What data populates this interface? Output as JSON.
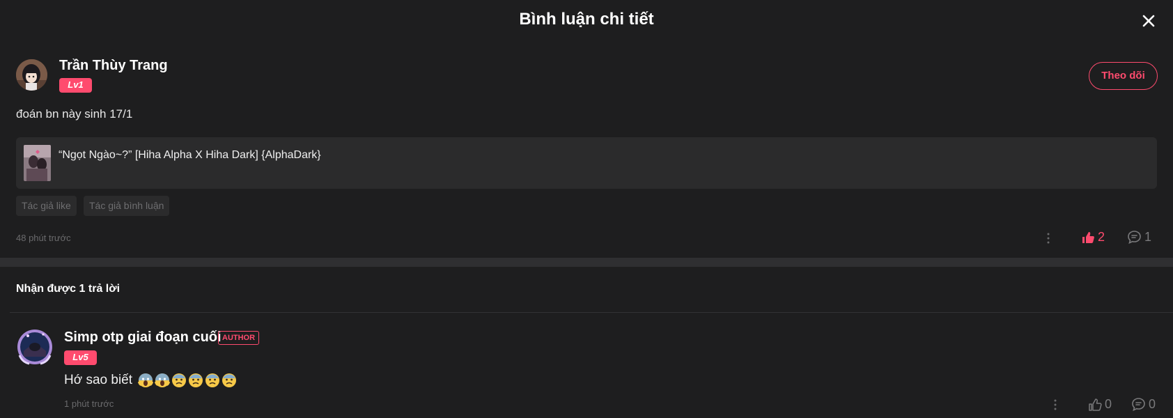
{
  "header": {
    "title": "Bình luận chi tiết"
  },
  "comment": {
    "user_name": "Trần Thùy Trang",
    "level": "Lv1",
    "follow_label": "Theo dõi",
    "text": "đoán bn này sinh 17/1",
    "story_title": "“Ngọt Ngào~?” [Hiha Alpha X Hiha Dark] {AlphaDark}",
    "tags": [
      "Tác giả like",
      "Tác giả bình luận"
    ],
    "time": "48 phút trước",
    "like_count": "2",
    "reply_count": "1"
  },
  "replies": {
    "heading": "Nhận được 1 trả lời",
    "items": [
      {
        "user_name": "Simp otp giai đoạn cuối",
        "badge": "AUTHOR",
        "level": "Lv5",
        "text": "Hớ sao biết",
        "emojis": [
          "screaming-face",
          "screaming-face",
          "anxious-face",
          "anxious-face",
          "anxious-face",
          "anxious-face"
        ],
        "time": "1 phút trước",
        "like_count": "0",
        "reply_count": "0"
      }
    ]
  },
  "colors": {
    "background": "#1e1e1f",
    "accent": "#ff4b6e",
    "card": "#2b2b2c",
    "muted_text": "#6a6a6c"
  }
}
